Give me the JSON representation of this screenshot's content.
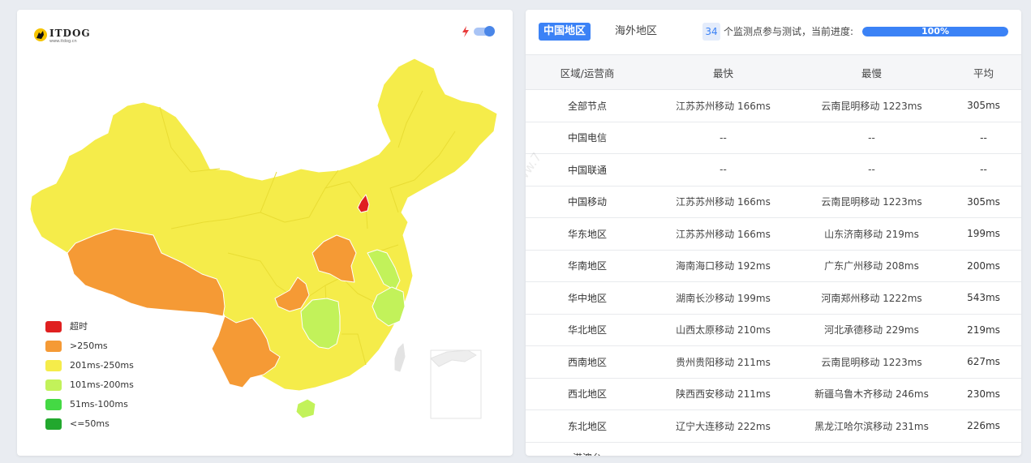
{
  "map_panel": {
    "logo_text": "ITDOG",
    "logo_url": "www.itdog.cn",
    "legend": [
      {
        "label": "超时",
        "color": "#e02020"
      },
      {
        "label": ">250ms",
        "color": "#f59a35"
      },
      {
        "label": "201ms-250ms",
        "color": "#f5ec4a"
      },
      {
        "label": "101ms-200ms",
        "color": "#c2f25a"
      },
      {
        "label": "51ms-100ms",
        "color": "#44d944"
      },
      {
        "label": "<=50ms",
        "color": "#22a82e"
      }
    ]
  },
  "table_panel": {
    "tabs": [
      "中国地区",
      "海外地区"
    ],
    "probe_count": "34",
    "probe_text": "个监测点参与测试，当前进度:",
    "progress_label": "100%",
    "progress_value": 1.0,
    "headers": [
      "区域/运营商",
      "最快",
      "最慢",
      "平均"
    ],
    "rows": [
      [
        "全部节点",
        "江苏苏州移动 166ms",
        "云南昆明移动 1223ms",
        "305ms"
      ],
      [
        "中国电信",
        "--",
        "--",
        "--"
      ],
      [
        "中国联通",
        "--",
        "--",
        "--"
      ],
      [
        "中国移动",
        "江苏苏州移动 166ms",
        "云南昆明移动 1223ms",
        "305ms"
      ],
      [
        "华东地区",
        "江苏苏州移动 166ms",
        "山东济南移动 219ms",
        "199ms"
      ],
      [
        "华南地区",
        "海南海口移动 192ms",
        "广东广州移动 208ms",
        "200ms"
      ],
      [
        "华中地区",
        "湖南长沙移动 199ms",
        "河南郑州移动 1222ms",
        "543ms"
      ],
      [
        "华北地区",
        "山西太原移动 210ms",
        "河北承德移动 229ms",
        "219ms"
      ],
      [
        "西南地区",
        "贵州贵阳移动 211ms",
        "云南昆明移动 1223ms",
        "627ms"
      ],
      [
        "西北地区",
        "陕西西安移动 211ms",
        "新疆乌鲁木齐移动 246ms",
        "230ms"
      ],
      [
        "东北地区",
        "辽宁大连移动 222ms",
        "黑龙江哈尔滨移动 231ms",
        "226ms"
      ],
      [
        "港澳台",
        "--",
        "--",
        "--"
      ]
    ]
  }
}
